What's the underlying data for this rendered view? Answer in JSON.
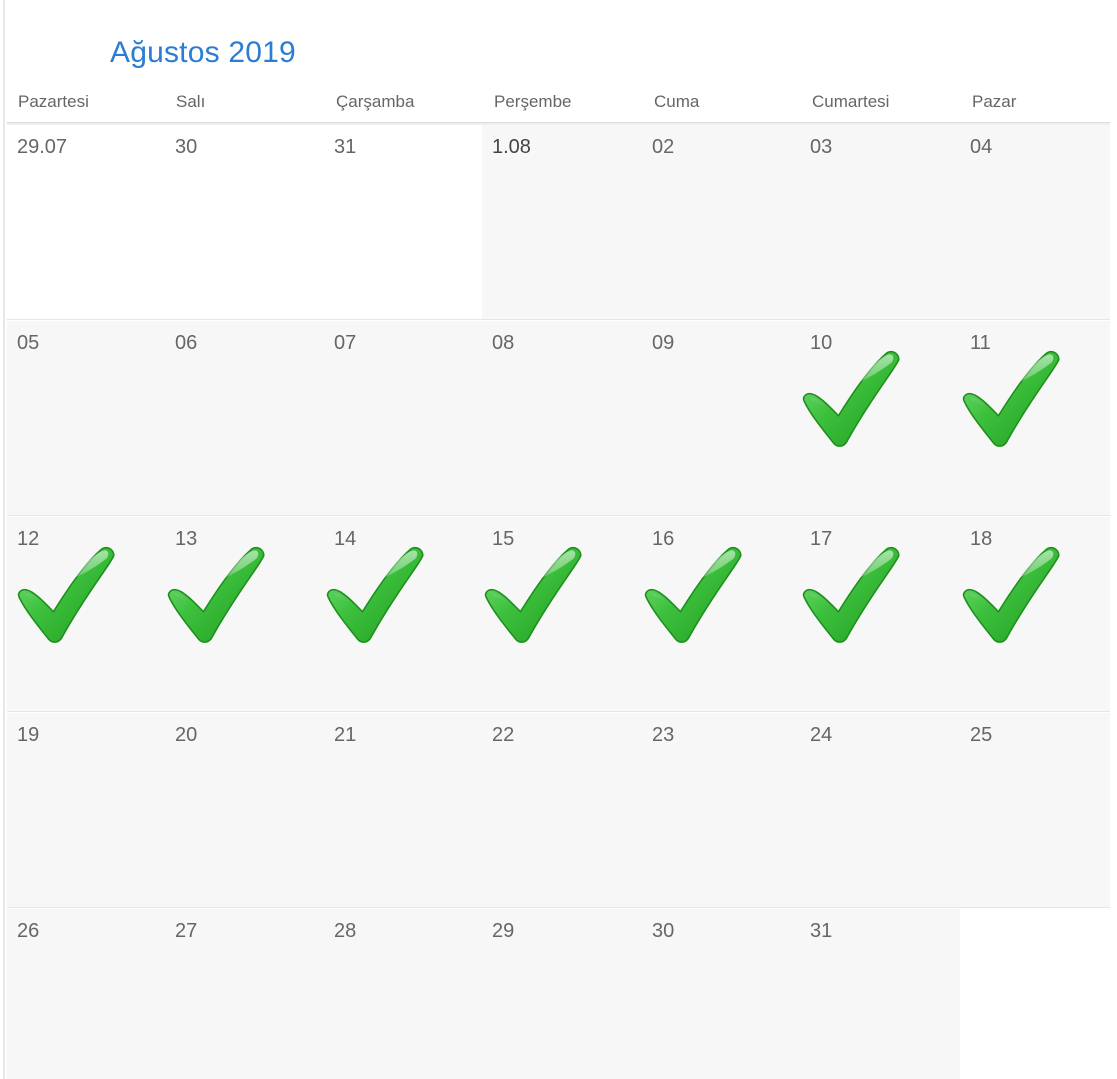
{
  "calendar": {
    "month_title": "Ağustos 2019",
    "weekdays": [
      "Pazartesi",
      "Salı",
      "Çarşamba",
      "Perşembe",
      "Cuma",
      "Cumartesi",
      "Pazar"
    ],
    "weeks": [
      {
        "days": [
          "29.07",
          "30",
          "31",
          "1.08",
          "02",
          "03",
          "04"
        ],
        "checked": [
          false,
          false,
          false,
          false,
          false,
          false,
          false
        ]
      },
      {
        "days": [
          "05",
          "06",
          "07",
          "08",
          "09",
          "10",
          "11"
        ],
        "checked": [
          false,
          false,
          false,
          false,
          false,
          true,
          true
        ]
      },
      {
        "days": [
          "12",
          "13",
          "14",
          "15",
          "16",
          "17",
          "18"
        ],
        "checked": [
          true,
          true,
          true,
          true,
          true,
          true,
          true
        ]
      },
      {
        "days": [
          "19",
          "20",
          "21",
          "22",
          "23",
          "24",
          "25"
        ],
        "checked": [
          false,
          false,
          false,
          false,
          false,
          false,
          false
        ]
      },
      {
        "days": [
          "26",
          "27",
          "28",
          "29",
          "30",
          "31",
          ""
        ],
        "checked": [
          false,
          false,
          false,
          false,
          false,
          false,
          false
        ]
      }
    ]
  },
  "colors": {
    "title": "#2b7cd3",
    "check_green": "#2fae2f",
    "cell_shade": "#f7f7f7"
  },
  "icons": {
    "check": "green-checkmark-icon"
  }
}
